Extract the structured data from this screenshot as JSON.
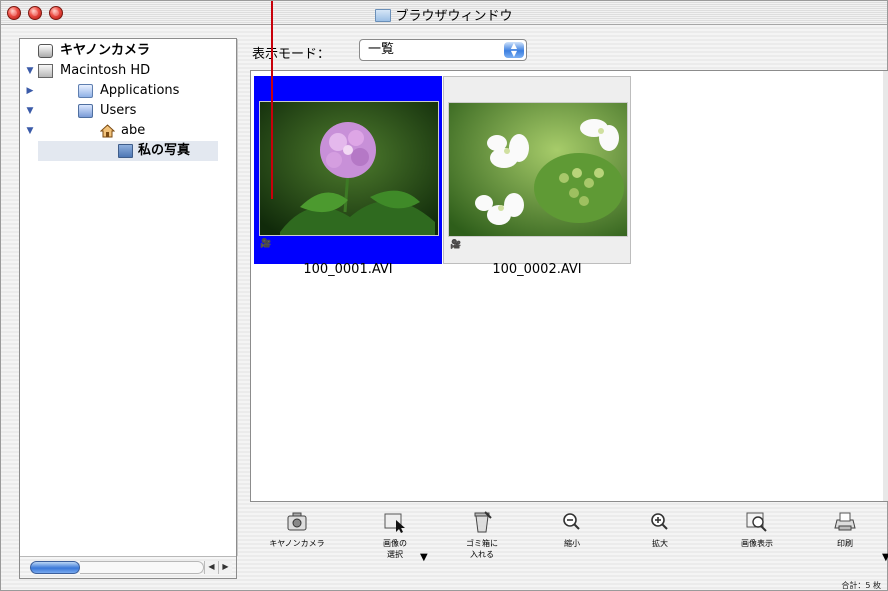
{
  "window": {
    "title": "ブラウザウィンドウ"
  },
  "sidebar": {
    "items": [
      {
        "label": "キヤノンカメラ",
        "expand": "",
        "icon": "camera-icon"
      },
      {
        "label": "Macintosh HD",
        "expand": "▼",
        "icon": "hard-disk-icon"
      },
      {
        "label": "Applications",
        "expand": "▶",
        "icon": "applications-folder-icon"
      },
      {
        "label": "Users",
        "expand": "▼",
        "icon": "users-folder-icon"
      },
      {
        "label": "abe",
        "expand": "▼",
        "icon": "home-icon"
      },
      {
        "label": "私の写真",
        "expand": "",
        "icon": "folder-icon"
      }
    ],
    "scroll_arrows": {
      "left": "◀",
      "right": "▶"
    }
  },
  "mode": {
    "label": "表示モード：",
    "selected": "一覧",
    "arrows": "▲▼"
  },
  "thumbnails": [
    {
      "name": "100_0001.AVI",
      "selected": true,
      "movie_icon": "🎥"
    },
    {
      "name": "100_0002.AVI",
      "selected": false,
      "movie_icon": "🎥"
    }
  ],
  "toolbar": {
    "camera": "キヤノンカメラ",
    "select": "画像の\n選択",
    "trash": "ゴミ箱に\n入れる",
    "zoom_out": "縮小",
    "zoom_in": "拡大",
    "view": "画像表示",
    "print": "印刷",
    "dropdown_glyph": "▼"
  },
  "status": {
    "total": "合計：5 枚"
  },
  "colors": {
    "selection": "#0000ff",
    "sidebar_selected": "#e3e8f0",
    "accent_blue": "#3a78d8",
    "annotation_red": "#c8000b"
  }
}
